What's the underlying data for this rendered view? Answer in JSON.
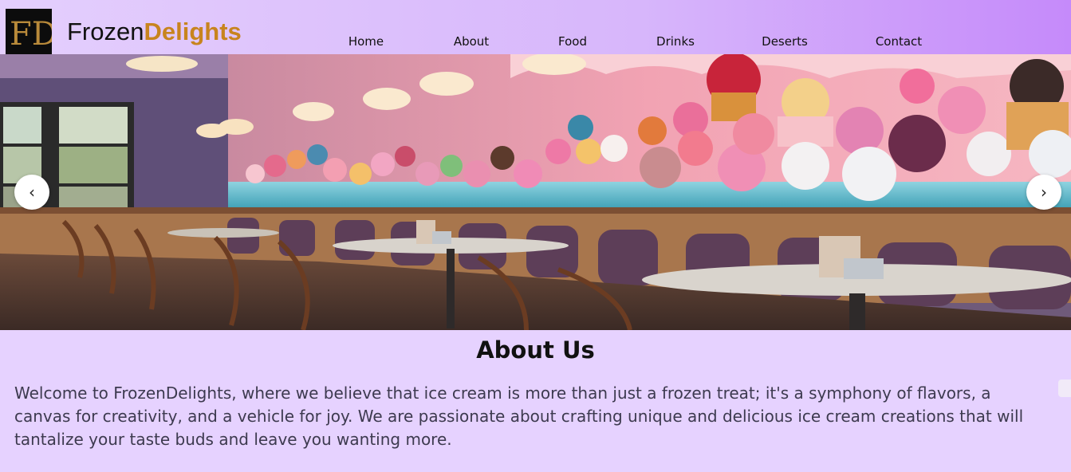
{
  "header": {
    "logo_text": "FD",
    "brand_part1": "Frozen",
    "brand_part2": "Delights",
    "nav": [
      "Home",
      "About",
      "Food",
      "Drinks",
      "Deserts",
      "Contact"
    ]
  },
  "hero": {
    "prev_label": "‹",
    "next_label": "›",
    "image": "ice-cream-parlor-interior"
  },
  "about": {
    "title": "About Us",
    "text": "Welcome to FrozenDelights, where we believe that ice cream is more than just a frozen treat; it's a symphony of flavors, a canvas for creativity, and a vehicle for joy. We are passionate about crafting unique and delicious ice cream creations that will tantalize your taste buds and leave you wanting more."
  },
  "colors": {
    "page_bg": "#e6d2ff",
    "header_start": "#e4cffd",
    "header_end": "#c58afa",
    "brand_accent": "#c8841e"
  }
}
